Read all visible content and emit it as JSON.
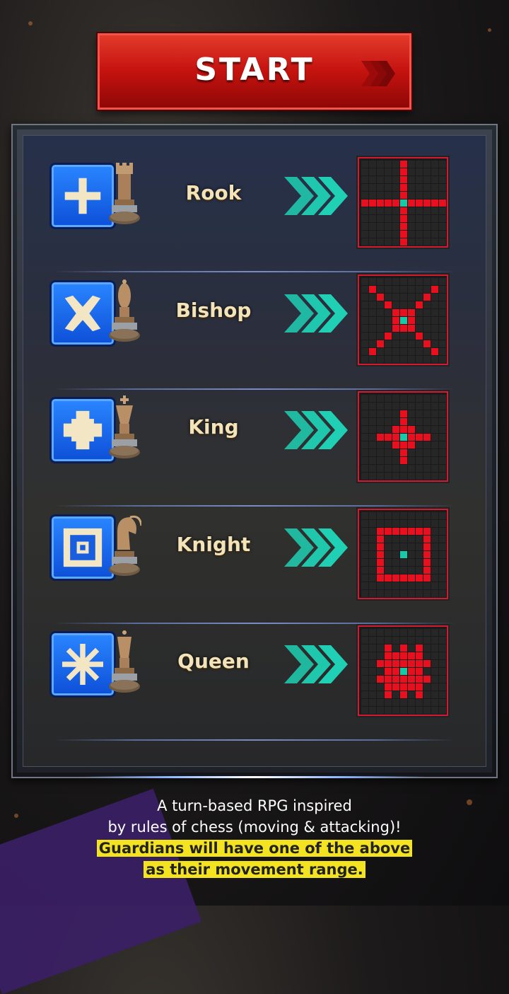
{
  "start_button": {
    "label": "START"
  },
  "pieces": [
    {
      "name": "Rook",
      "range": [
        [
          5,
          0
        ],
        [
          5,
          1
        ],
        [
          5,
          2
        ],
        [
          5,
          3
        ],
        [
          5,
          4
        ],
        [
          0,
          5
        ],
        [
          1,
          5
        ],
        [
          2,
          5
        ],
        [
          3,
          5
        ],
        [
          4,
          5
        ],
        [
          6,
          5
        ],
        [
          7,
          5
        ],
        [
          8,
          5
        ],
        [
          9,
          5
        ],
        [
          10,
          5
        ],
        [
          5,
          6
        ],
        [
          5,
          7
        ],
        [
          5,
          8
        ],
        [
          5,
          9
        ],
        [
          5,
          10
        ]
      ]
    },
    {
      "name": "Bishop",
      "range": [
        [
          1,
          1
        ],
        [
          9,
          1
        ],
        [
          2,
          2
        ],
        [
          8,
          2
        ],
        [
          3,
          3
        ],
        [
          7,
          3
        ],
        [
          4,
          4
        ],
        [
          6,
          4
        ],
        [
          4,
          6
        ],
        [
          6,
          6
        ],
        [
          3,
          7
        ],
        [
          7,
          7
        ],
        [
          2,
          8
        ],
        [
          8,
          8
        ],
        [
          1,
          9
        ],
        [
          9,
          9
        ],
        [
          5,
          4
        ],
        [
          4,
          5
        ],
        [
          6,
          5
        ],
        [
          5,
          6
        ]
      ]
    },
    {
      "name": "King",
      "range": [
        [
          5,
          2
        ],
        [
          5,
          3
        ],
        [
          4,
          4
        ],
        [
          5,
          4
        ],
        [
          6,
          4
        ],
        [
          2,
          5
        ],
        [
          3,
          5
        ],
        [
          4,
          5
        ],
        [
          6,
          5
        ],
        [
          7,
          5
        ],
        [
          8,
          5
        ],
        [
          4,
          6
        ],
        [
          5,
          6
        ],
        [
          6,
          6
        ],
        [
          5,
          7
        ],
        [
          5,
          8
        ]
      ]
    },
    {
      "name": "Knight",
      "range": [
        [
          2,
          2
        ],
        [
          3,
          2
        ],
        [
          4,
          2
        ],
        [
          5,
          2
        ],
        [
          6,
          2
        ],
        [
          7,
          2
        ],
        [
          8,
          2
        ],
        [
          2,
          3
        ],
        [
          8,
          3
        ],
        [
          2,
          4
        ],
        [
          8,
          4
        ],
        [
          2,
          5
        ],
        [
          8,
          5
        ],
        [
          2,
          6
        ],
        [
          8,
          6
        ],
        [
          2,
          7
        ],
        [
          8,
          7
        ],
        [
          2,
          8
        ],
        [
          3,
          8
        ],
        [
          4,
          8
        ],
        [
          5,
          8
        ],
        [
          6,
          8
        ],
        [
          7,
          8
        ],
        [
          8,
          8
        ]
      ]
    },
    {
      "name": "Queen",
      "range": [
        [
          3,
          2
        ],
        [
          5,
          2
        ],
        [
          7,
          2
        ],
        [
          3,
          3
        ],
        [
          4,
          3
        ],
        [
          5,
          3
        ],
        [
          6,
          3
        ],
        [
          7,
          3
        ],
        [
          2,
          4
        ],
        [
          3,
          4
        ],
        [
          4,
          4
        ],
        [
          5,
          4
        ],
        [
          6,
          4
        ],
        [
          7,
          4
        ],
        [
          8,
          4
        ],
        [
          3,
          5
        ],
        [
          4,
          5
        ],
        [
          6,
          5
        ],
        [
          7,
          5
        ],
        [
          2,
          6
        ],
        [
          3,
          6
        ],
        [
          4,
          6
        ],
        [
          5,
          6
        ],
        [
          6,
          6
        ],
        [
          7,
          6
        ],
        [
          8,
          6
        ],
        [
          3,
          7
        ],
        [
          4,
          7
        ],
        [
          5,
          7
        ],
        [
          6,
          7
        ],
        [
          7,
          7
        ],
        [
          3,
          8
        ],
        [
          5,
          8
        ],
        [
          7,
          8
        ]
      ]
    }
  ],
  "caption": {
    "line1": "A turn-based RPG inspired",
    "line2": "by rules of chess (moving & attacking)!",
    "line3": "Guardians will have one of the above",
    "line4": "as their movement range."
  },
  "colors": {
    "range": "#e8101e",
    "center": "#17c9a8",
    "accent": "#e4d2a2",
    "arrow": "#1fd0b4"
  }
}
